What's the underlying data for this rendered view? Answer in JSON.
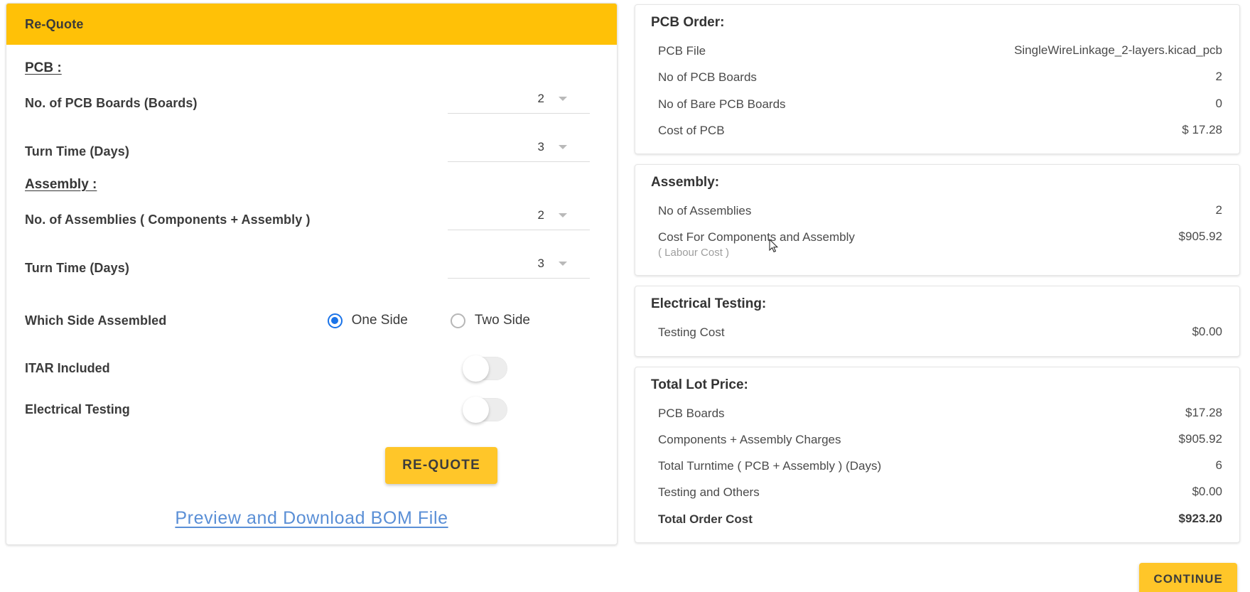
{
  "left": {
    "header_title": "Re-Quote",
    "pcb_section_title": "PCB :",
    "assembly_section_title": "Assembly :",
    "fields": {
      "pcb_boards_label": "No. of PCB Boards (Boards)",
      "pcb_boards_value": "2",
      "pcb_turntime_label": "Turn Time (Days)",
      "pcb_turntime_value": "3",
      "assemblies_label": "No. of Assemblies ( Components + Assembly )",
      "assemblies_value": "2",
      "assembly_turntime_label": "Turn Time (Days)",
      "assembly_turntime_value": "3",
      "which_side_label": "Which Side Assembled",
      "one_side_label": "One Side",
      "two_side_label": "Two Side",
      "one_side_selected": true,
      "itar_label": "ITAR Included",
      "itar_on": false,
      "electrical_testing_label": "Electrical Testing",
      "electrical_testing_on": false
    },
    "requote_button": "RE-QUOTE",
    "bom_link": "Preview and Download BOM File"
  },
  "right": {
    "pcb_order": {
      "title": "PCB Order:",
      "rows": [
        {
          "key": "PCB File",
          "value": "SingleWireLinkage_2-layers.kicad_pcb"
        },
        {
          "key": "No of PCB Boards",
          "value": "2"
        },
        {
          "key": "No of Bare PCB Boards",
          "value": "0"
        },
        {
          "key": "Cost of PCB",
          "value": "$ 17.28"
        }
      ]
    },
    "assembly": {
      "title": "Assembly:",
      "rows": [
        {
          "key": "No of Assemblies",
          "sub": "",
          "value": "2"
        },
        {
          "key": "Cost For Components and Assembly",
          "sub": "( Labour Cost )",
          "value": "$905.92"
        }
      ]
    },
    "electrical_testing": {
      "title": "Electrical Testing:",
      "rows": [
        {
          "key": "Testing Cost",
          "value": "$0.00"
        }
      ]
    },
    "total_lot_price": {
      "title": "Total Lot Price:",
      "rows": [
        {
          "key": "PCB Boards",
          "value": "$17.28",
          "bold": false
        },
        {
          "key": "Components + Assembly Charges",
          "value": "$905.92",
          "bold": false
        },
        {
          "key": "Total Turntime ( PCB + Assembly ) (Days)",
          "value": "6",
          "bold": false
        },
        {
          "key": "Testing and Others",
          "value": "$0.00",
          "bold": false
        },
        {
          "key": "Total Order Cost",
          "value": "$923.20",
          "bold": true
        }
      ]
    },
    "continue_button": "CONTINUE"
  },
  "colors": {
    "accent_yellow": "#ffc107",
    "button_yellow": "#ffc629",
    "radio_blue": "#1a73e8",
    "link_blue": "#5a8fd6"
  }
}
